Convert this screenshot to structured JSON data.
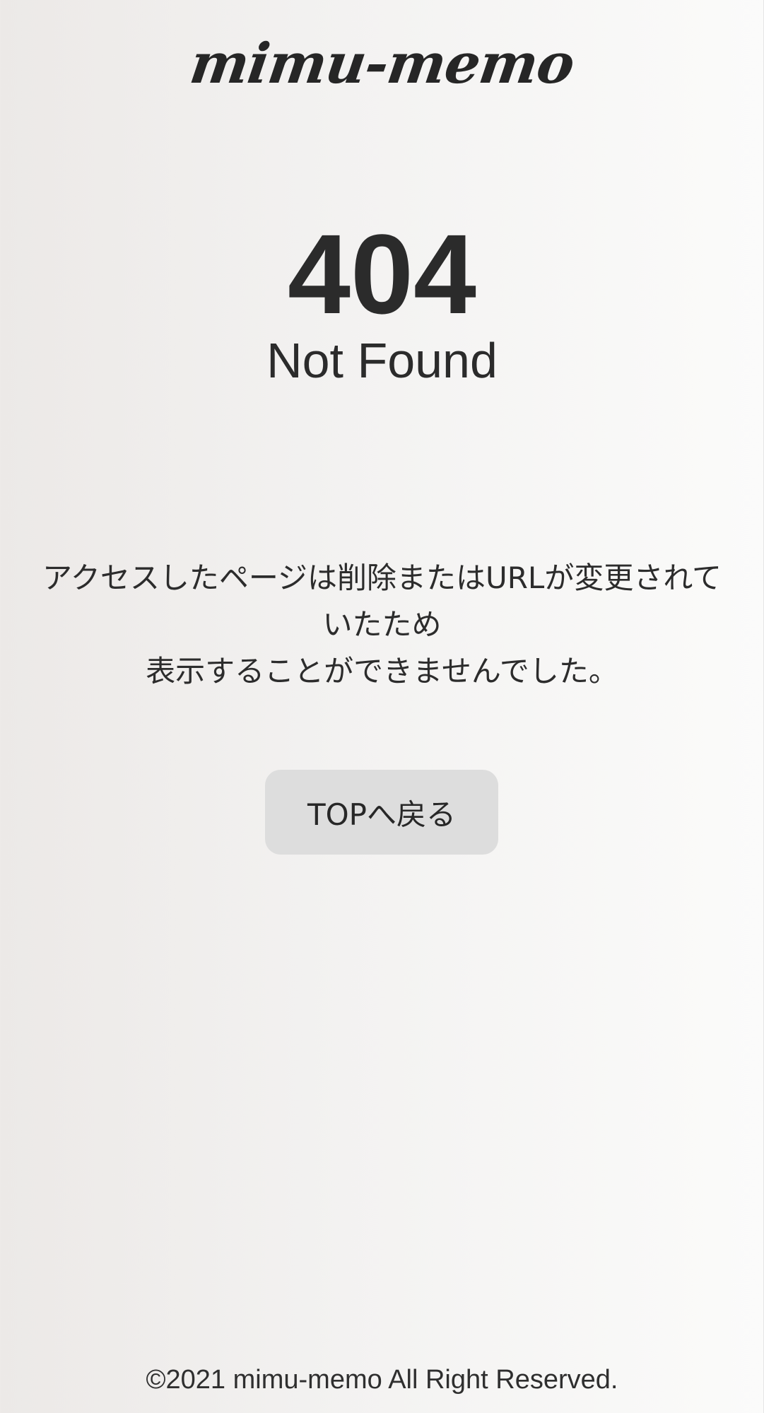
{
  "header": {
    "logo_text": "mimu-memo"
  },
  "error": {
    "code": "404",
    "title": "Not Found"
  },
  "message": {
    "line1": "アクセスしたページは削除またはURLが変更されて",
    "line2": "いたため",
    "line3": "表示することができませんでした。"
  },
  "actions": {
    "back_to_top_label": "TOPへ戻る"
  },
  "footer": {
    "copyright": "©2021 mimu-memo All Right Reserved."
  }
}
